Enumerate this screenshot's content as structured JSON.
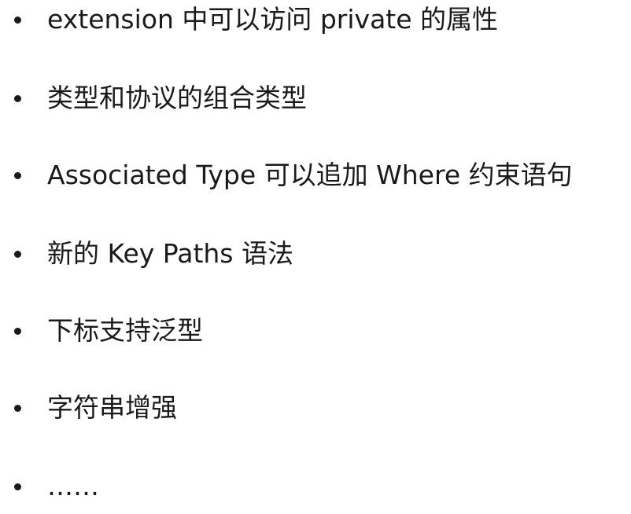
{
  "slide": {
    "bullets": [
      "extension 中可以访问 private 的属性",
      "类型和协议的组合类型",
      "Associated Type 可以追加 Where 约束语句",
      "新的 Key Paths 语法",
      "下标支持泛型",
      "字符串增强",
      "……"
    ]
  }
}
